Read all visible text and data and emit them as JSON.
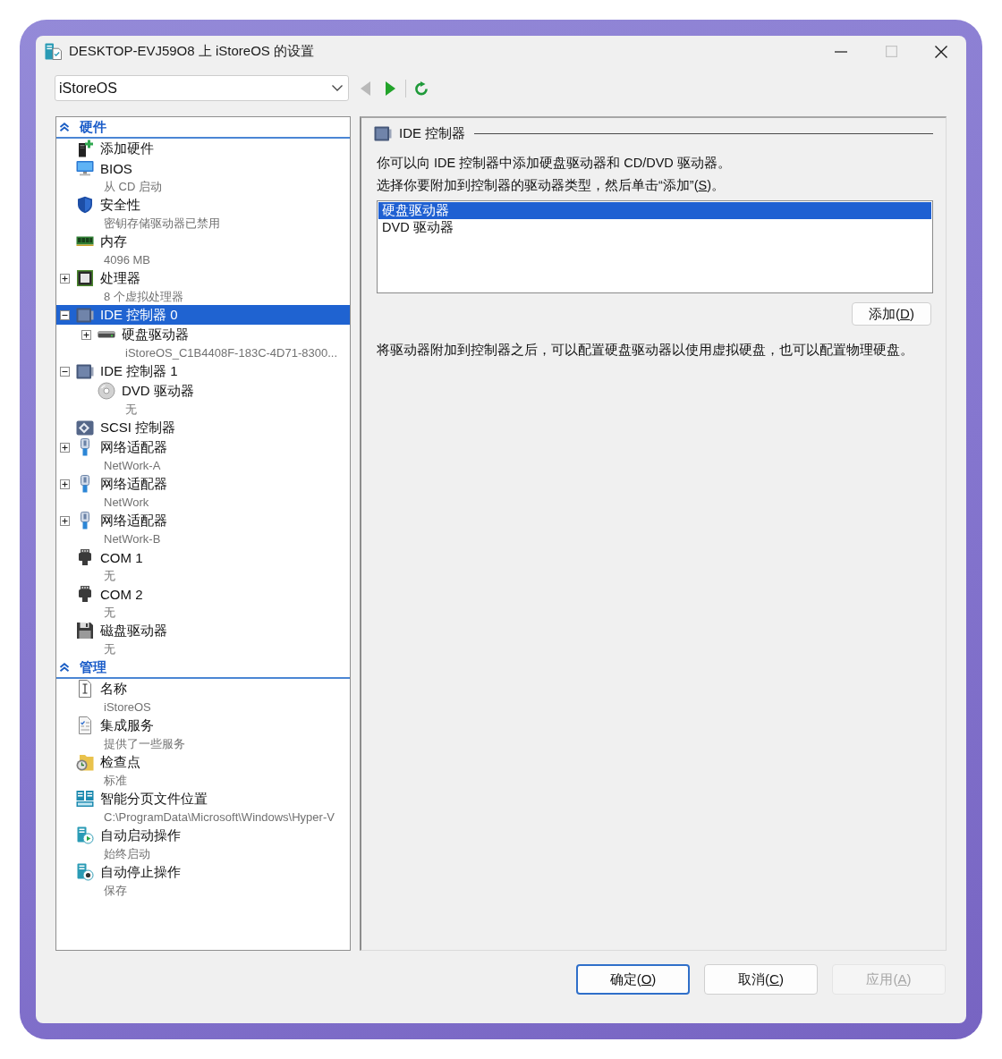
{
  "window": {
    "title": "DESKTOP-EVJ59O8 上 iStoreOS 的设置",
    "controls": [
      {
        "kind": "minimize",
        "disabled": false
      },
      {
        "kind": "maximize",
        "disabled": true
      },
      {
        "kind": "close",
        "disabled": false
      }
    ]
  },
  "toolbar": {
    "vm_select": {
      "value": "iStoreOS"
    },
    "nav": [
      {
        "kind": "back",
        "disabled": true
      },
      {
        "kind": "forward",
        "disabled": false
      },
      {
        "kind": "refresh",
        "disabled": false
      }
    ]
  },
  "settings_tree": {
    "sections": [
      {
        "title": "硬件",
        "expanded": true,
        "items": [
          {
            "kind": "add-hardware",
            "label": "添加硬件",
            "selected": false
          },
          {
            "kind": "bios",
            "label": "BIOS",
            "detail": "从 CD 启动",
            "selected": false
          },
          {
            "kind": "security",
            "label": "安全性",
            "detail": "密钥存储驱动器已禁用",
            "selected": false
          },
          {
            "kind": "memory",
            "label": "内存",
            "detail": "4096 MB",
            "selected": false
          },
          {
            "kind": "processor",
            "label": "处理器",
            "detail": "8 个虚拟处理器",
            "selected": false,
            "expanded": false
          },
          {
            "kind": "ide-controller",
            "label": "IDE 控制器 0",
            "selected": true,
            "expanded": true,
            "children": [
              {
                "kind": "hard-drive",
                "label": "硬盘驱动器",
                "detail": "iStoreOS_C1B4408F-183C-4D71-8300...",
                "selected": false,
                "expanded": false
              }
            ]
          },
          {
            "kind": "ide-controller",
            "label": "IDE 控制器 1",
            "selected": false,
            "expanded": true,
            "children": [
              {
                "kind": "dvd-drive",
                "label": "DVD 驱动器",
                "detail": "无",
                "selected": false
              }
            ]
          },
          {
            "kind": "scsi-controller",
            "label": "SCSI 控制器",
            "selected": false
          },
          {
            "kind": "network-adapter",
            "label": "网络适配器",
            "detail": "NetWork-A",
            "selected": false,
            "expanded": false
          },
          {
            "kind": "network-adapter",
            "label": "网络适配器",
            "detail": "NetWork",
            "selected": false,
            "expanded": false
          },
          {
            "kind": "network-adapter",
            "label": "网络适配器",
            "detail": "NetWork-B",
            "selected": false,
            "expanded": false
          },
          {
            "kind": "com-port",
            "label": "COM 1",
            "detail": "无",
            "selected": false
          },
          {
            "kind": "com-port",
            "label": "COM 2",
            "detail": "无",
            "selected": false
          },
          {
            "kind": "floppy",
            "label": "磁盘驱动器",
            "detail": "无",
            "selected": false
          }
        ]
      },
      {
        "title": "管理",
        "expanded": true,
        "items": [
          {
            "kind": "name",
            "label": "名称",
            "detail": "iStoreOS",
            "selected": false
          },
          {
            "kind": "integration-services",
            "label": "集成服务",
            "detail": "提供了一些服务",
            "selected": false
          },
          {
            "kind": "checkpoint",
            "label": "检查点",
            "detail": "标准",
            "selected": false
          },
          {
            "kind": "paging-file",
            "label": "智能分页文件位置",
            "detail": "C:\\ProgramData\\Microsoft\\Windows\\Hyper-V",
            "selected": false
          },
          {
            "kind": "auto-start",
            "label": "自动启动操作",
            "detail": "始终启动",
            "selected": false
          },
          {
            "kind": "auto-stop",
            "label": "自动停止操作",
            "detail": "保存",
            "selected": false
          }
        ]
      }
    ]
  },
  "detail_pane": {
    "title": "IDE 控制器",
    "intro": [
      "你可以向 IDE 控制器中添加硬盘驱动器和 CD/DVD 驱动器。",
      "选择你要附加到控制器的驱动器类型，然后单击“添加”(S)。"
    ],
    "drive_types": [
      {
        "label": "硬盘驱动器",
        "selected": true
      },
      {
        "label": "DVD 驱动器",
        "selected": false
      }
    ],
    "add_button": {
      "label": "添加(D)"
    },
    "note": "将驱动器附加到控制器之后，可以配置硬盘驱动器以使用虚拟硬盘，也可以配置物理硬盘。"
  },
  "buttons": [
    {
      "label": "确定(O)",
      "default": true,
      "disabled": false
    },
    {
      "label": "取消(C)",
      "default": false,
      "disabled": false
    },
    {
      "label": "应用(A)",
      "default": false,
      "disabled": true
    }
  ]
}
